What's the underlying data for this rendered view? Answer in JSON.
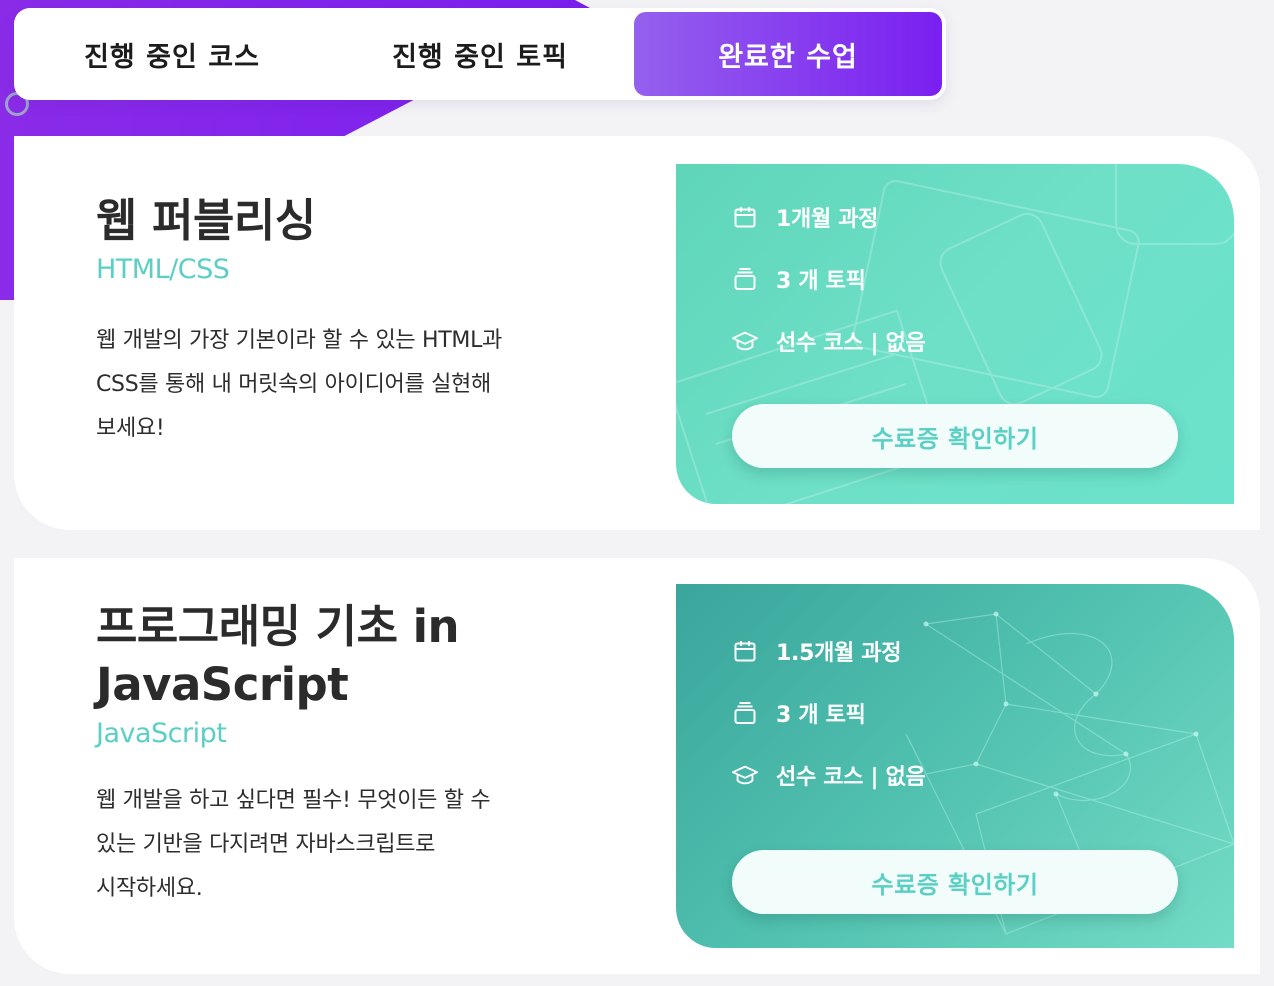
{
  "tabs": [
    {
      "label": "진행 중인 코스",
      "active": false
    },
    {
      "label": "진행 중인 토픽",
      "active": false
    },
    {
      "label": "완료한 수업",
      "active": true
    }
  ],
  "courses": [
    {
      "title": "웹 퍼블리싱",
      "subtitle": "HTML/CSS",
      "description_lines": [
        "웹 개발의 가장 기본이라 할 수 있는 HTML과",
        "CSS를 통해 내 머릿속의 아이디어를 실현해",
        "보세요!"
      ],
      "duration": "1개월 과정",
      "topics": "3 개 토픽",
      "prerequisite": "선수 코스 | 없음",
      "button_label": "수료증 확인하기"
    },
    {
      "title_lines": [
        "프로그래밍 기초 in",
        "JavaScript"
      ],
      "subtitle": "JavaScript",
      "description_lines": [
        "웹 개발을 하고 싶다면 필수! 무엇이든 할 수",
        "있는 기반을 다지려면 자바스크립트로",
        "시작하세요."
      ],
      "duration": "1.5개월 과정",
      "topics": "3 개 토픽",
      "prerequisite": "선수 코스 | 없음",
      "button_label": "수료증 확인하기"
    }
  ],
  "icons": {
    "duration": "calendar-icon",
    "topics": "stack-icon",
    "prerequisite": "graduation-cap-icon"
  },
  "colors": {
    "accent_purple": "#7a1ff0",
    "accent_teal": "#5ccfc4"
  }
}
